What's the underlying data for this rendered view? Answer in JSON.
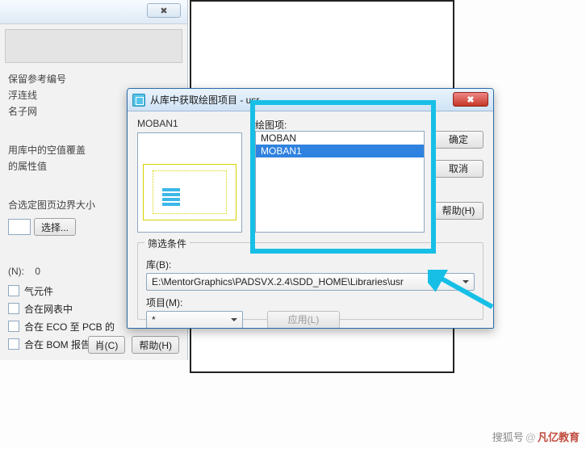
{
  "bg": {
    "close_glyph": "✖",
    "options": {
      "o1": "保留参考编号",
      "o2": "浮连线",
      "o3": "名子网",
      "o4": "用库中的空值覆盖",
      "o5": "的属性值",
      "o6": "合选定图页边界大小"
    },
    "select_btn": "选择...",
    "n_label": "(N):",
    "n_value": "0",
    "c1": "气元件",
    "c2": "合在网表中",
    "c3": "合在 ECO 至 PCB 的",
    "c4": "合在 BOM 报告中",
    "cancel": "肖(C)",
    "help": "帮助(H)"
  },
  "dlg": {
    "title": "从库中获取绘图项目 - usr",
    "close_glyph": "✖",
    "preview_name": "MOBAN1",
    "list_label": "绘图项:",
    "items": {
      "i0": "MOBAN",
      "i1": "MOBAN1"
    },
    "ok": "确定",
    "cancel": "取消",
    "help": "帮助(H)",
    "filter": {
      "legend": "筛选条件",
      "lib_label": "库(B):",
      "lib_value": "E:\\MentorGraphics\\PADSVX.2.4\\SDD_HOME\\Libraries\\usr",
      "item_label": "项目(M):",
      "item_value": "*",
      "apply": "应用(L)"
    }
  },
  "wm": {
    "left": "搜狐号",
    "sep": "@",
    "right": "凡亿教育"
  }
}
